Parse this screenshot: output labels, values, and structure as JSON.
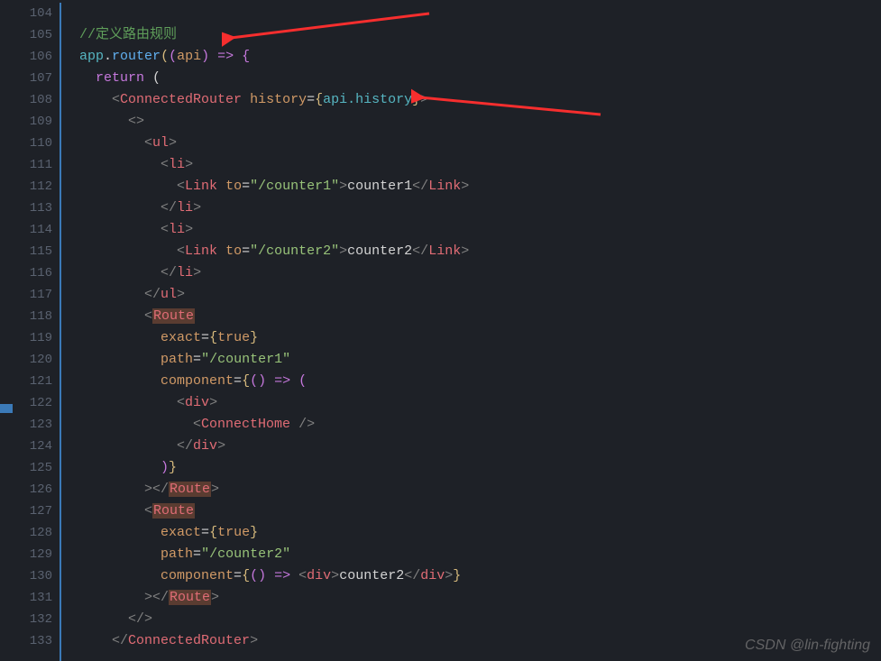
{
  "lineNumbers": [
    "104",
    "105",
    "106",
    "107",
    "108",
    "109",
    "110",
    "111",
    "112",
    "113",
    "114",
    "115",
    "116",
    "117",
    "118",
    "119",
    "120",
    "121",
    "122",
    "123",
    "124",
    "125",
    "126",
    "127",
    "128",
    "129",
    "130",
    "131",
    "132",
    "133"
  ],
  "tokens": {
    "comment": "//定义路由规则",
    "app": "app",
    "router": "router",
    "api": "api",
    "return": "return",
    "ConnectedRouter": "ConnectedRouter",
    "history": "history",
    "apiHistory": "api.history",
    "ul": "ul",
    "li": "li",
    "Link": "Link",
    "to": "to",
    "counter1Path": "\"/counter1\"",
    "counter2Path": "\"/counter2\"",
    "counter1": "counter1",
    "counter2": "counter2",
    "Route": "Route",
    "exact": "exact",
    "true": "true",
    "path": "path",
    "component": "component",
    "div": "div",
    "ConnectHome": "ConnectHome"
  },
  "watermark": "CSDN @lin-fighting"
}
